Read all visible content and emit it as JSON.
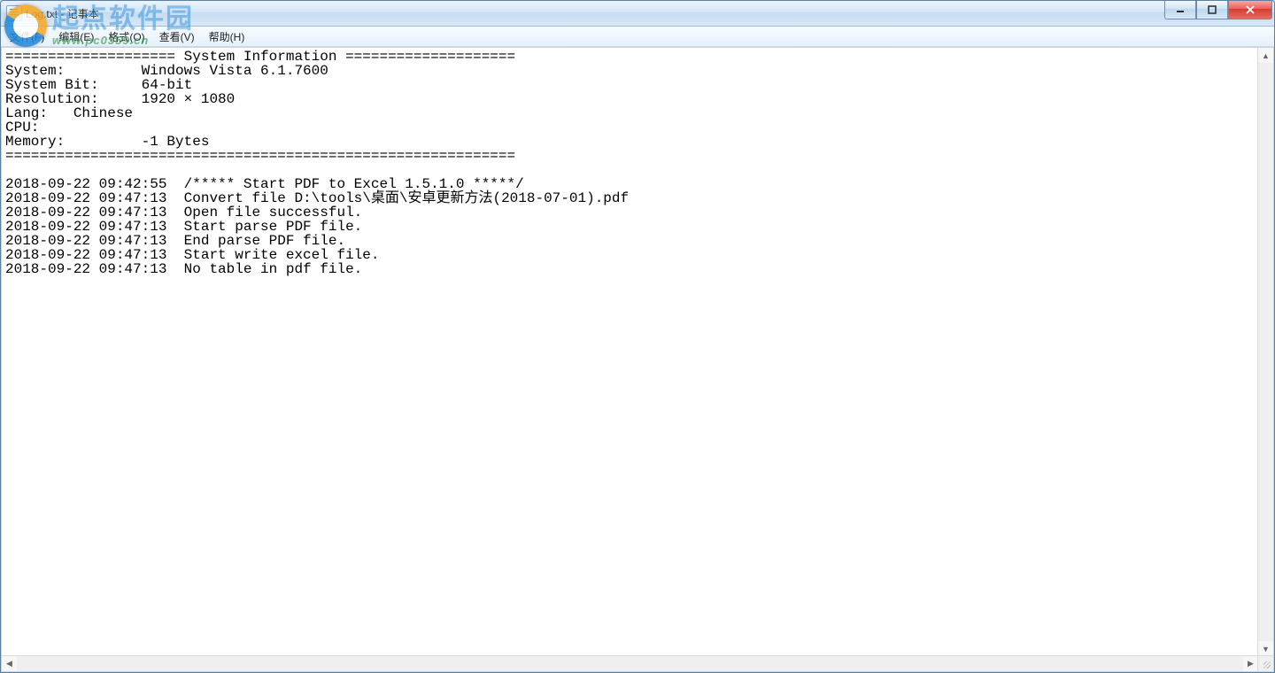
{
  "titlebar": {
    "title": "Log.txt - 记事本"
  },
  "menubar": {
    "file": "文件(F)",
    "edit": "编辑(E)",
    "format": "格式(O)",
    "view": "查看(V)",
    "help": "帮助(H)"
  },
  "content": "==================== System Information ====================\nSystem:         Windows Vista 6.1.7600\nSystem Bit:     64-bit\nResolution:     1920 × 1080\nLang:   Chinese\nCPU:\nMemory:         -1 Bytes\n============================================================\n\n2018-09-22 09:42:55  /***** Start PDF to Excel 1.5.1.0 *****/\n2018-09-22 09:47:13  Convert file D:\\tools\\桌面\\安卓更新方法(2018-07-01).pdf\n2018-09-22 09:47:13  Open file successful.\n2018-09-22 09:47:13  Start parse PDF file.\n2018-09-22 09:47:13  End parse PDF file.\n2018-09-22 09:47:13  Start write excel file.\n2018-09-22 09:47:13  No table in pdf file.\n",
  "watermark": {
    "main": "起点软件园",
    "sub": "www.pc0359.cn"
  },
  "scroll": {
    "up": "▲",
    "down": "▼",
    "left": "◀",
    "right": "▶"
  }
}
